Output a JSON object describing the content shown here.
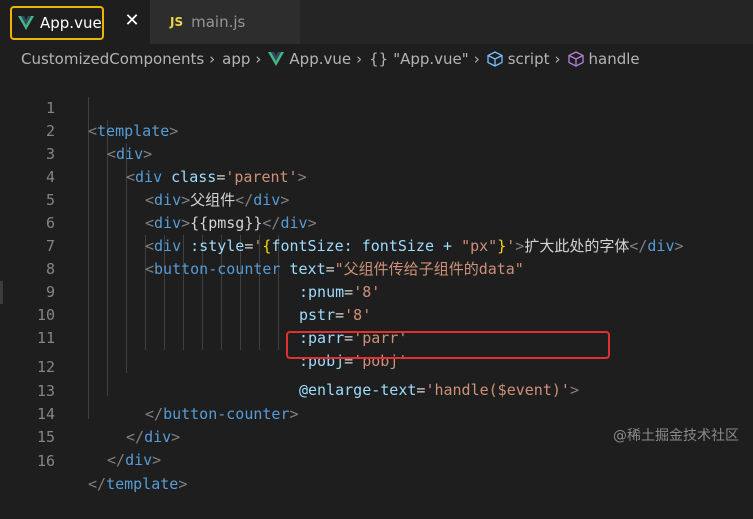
{
  "tabs": [
    {
      "label": "App.vue",
      "icon": "vue-icon",
      "active": true
    },
    {
      "label": "main.js",
      "icon": "js-icon",
      "icon_text": "JS",
      "active": false
    }
  ],
  "close_glyph": "✕",
  "breadcrumb": {
    "items": [
      "CustomizedComponents",
      "app",
      "App.vue",
      "\"App.vue\"",
      "script",
      "handle"
    ],
    "braces": "{}"
  },
  "editor": {
    "line_numbers": [
      "1",
      "2",
      "3",
      "4",
      "5",
      "6",
      "7",
      "8",
      "9",
      "10",
      "11",
      "12",
      "13",
      "14",
      "15",
      "16"
    ]
  },
  "code": {
    "l1": {
      "open": "<",
      "tag": "template",
      "close": ">"
    },
    "l2": {
      "open": "<",
      "tag": "div",
      "close": ">"
    },
    "l3": {
      "open": "<",
      "tag": "div",
      "attr": " class",
      "eq": "=",
      "val": "'parent'",
      "close": ">"
    },
    "l4": {
      "open": "<",
      "tag": "div",
      "close": ">",
      "text": "父组件",
      "end_open": "</",
      "end_tag": "div",
      "end_close": ">"
    },
    "l5": {
      "open": "<",
      "tag": "div",
      "close": ">",
      "text": "{{pmsg}}",
      "end_open": "</",
      "end_tag": "div",
      "end_close": ">"
    },
    "l6": {
      "open": "<",
      "tag": "div",
      "attr": " :style",
      "eq": "=",
      "q1": "'",
      "b1": "{",
      "expr1": "fontSize: fontSize + ",
      "s": "\"px\"",
      "b2": "}",
      "q2": "'",
      "close": ">",
      "text": "扩大此处的字体",
      "end_open": "</",
      "end_tag": "div",
      "end_close": ">"
    },
    "l7": {
      "open": "<",
      "tag": "button-counter",
      "attr": " text",
      "eq": "=",
      "val": "\"父组件传给子组件的data\""
    },
    "l8": {
      "attr": ":pnum",
      "eq": "=",
      "val": "'8'"
    },
    "l9": {
      "attr": "pstr",
      "eq": "=",
      "val": "'8'"
    },
    "l10": {
      "attr": ":parr",
      "eq": "=",
      "val": "'parr'"
    },
    "l11": {
      "attr": ":pobj",
      "eq": "=",
      "val": "'pobj'"
    },
    "l12": {
      "attr": "@enlarge-text",
      "eq": "=",
      "val": "'handle($event)'",
      "close": ">"
    },
    "l13": {
      "open": "</",
      "tag": "button-counter",
      "close": ">"
    },
    "l14": {
      "open": "</",
      "tag": "div",
      "close": ">"
    },
    "l15": {
      "open": "</",
      "tag": "div",
      "close": ">"
    },
    "l16": {
      "open": "</",
      "tag": "template",
      "close": ">"
    }
  },
  "watermark": "@稀土掘金技术社区",
  "colors": {
    "tag": "#569cd6",
    "attr": "#9cdcfe",
    "string": "#ce9178",
    "highlight_box": "#e03030",
    "focus_box": "#f0b400"
  }
}
